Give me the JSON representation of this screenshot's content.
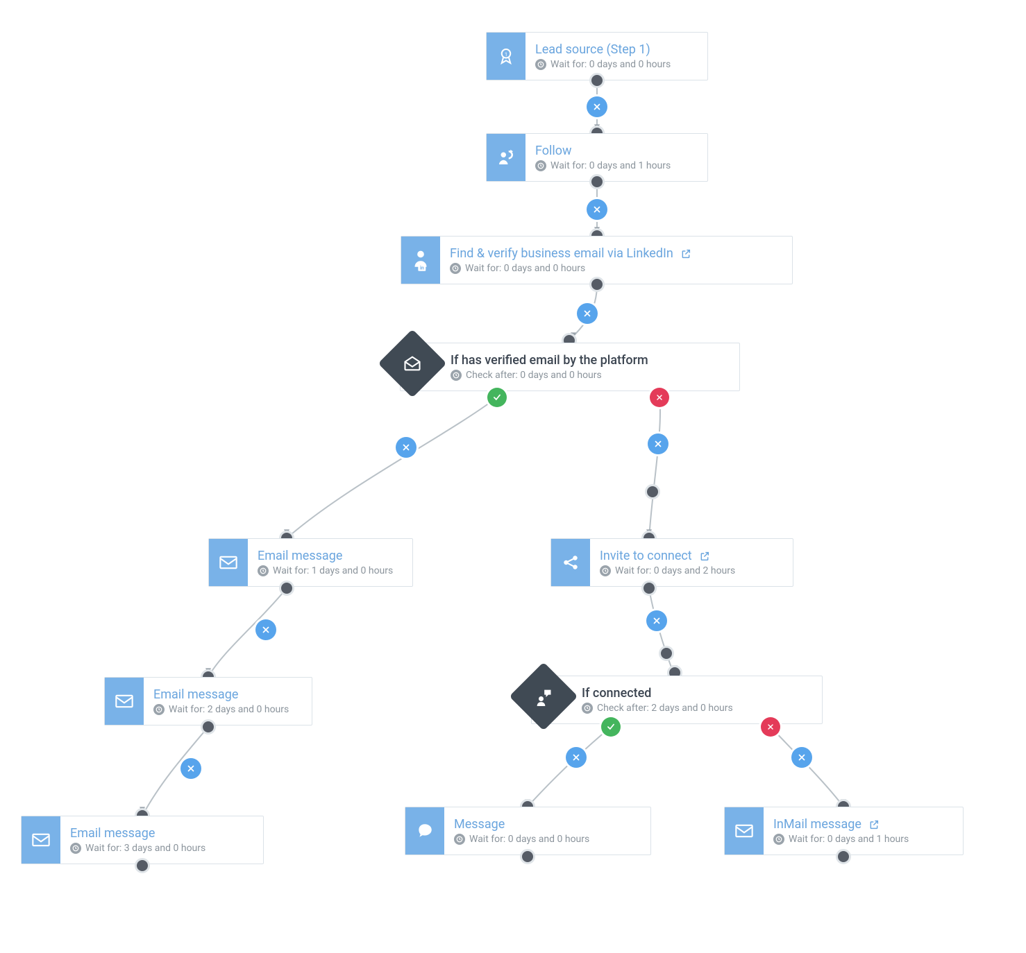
{
  "labels": {
    "wait_prefix": "Wait for:",
    "check_prefix": "Check after:"
  },
  "nodes": {
    "lead": {
      "title": "Lead source (Step 1)",
      "sub": "Wait for: 0 days and 0 hours"
    },
    "follow": {
      "title": "Follow",
      "sub": "Wait for: 0 days and 1 hours"
    },
    "verify": {
      "title": "Find & verify business email via LinkedIn",
      "sub": "Wait for: 0 days and 0 hours"
    },
    "ifemail": {
      "title": "If has verified email by the platform",
      "sub": "Check after: 0 days and 0 hours"
    },
    "email1": {
      "title": "Email message",
      "sub": "Wait for: 1 days and 0 hours"
    },
    "email2": {
      "title": "Email message",
      "sub": "Wait for: 2 days and 0 hours"
    },
    "email3": {
      "title": "Email message",
      "sub": "Wait for: 3 days and 0 hours"
    },
    "invite": {
      "title": "Invite to connect",
      "sub": "Wait for: 0 days and 2 hours"
    },
    "ifconn": {
      "title": "If connected",
      "sub": "Check after: 2 days and 0 hours"
    },
    "message": {
      "title": "Message",
      "sub": "Wait for: 0 days and 0 hours"
    },
    "inmail": {
      "title": "InMail message",
      "sub": "Wait for: 0 days and 1 hours"
    }
  }
}
